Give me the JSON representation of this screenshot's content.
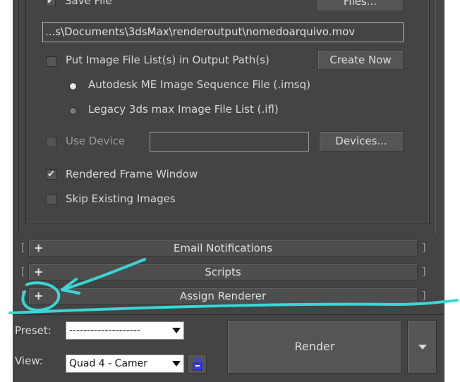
{
  "output": {
    "save_file_label": "Save File",
    "files_button": "Files...",
    "path_value": "...s\\Documents\\3dsMax\\renderoutput\\nomedoarquivo.mov",
    "put_image_list_label": "Put Image File List(s) in Output Path(s)",
    "put_image_list_checked": false,
    "create_now_button": "Create Now",
    "radio_imsq_label": "Autodesk ME Image Sequence File (.imsq)",
    "radio_ifl_label": "Legacy 3ds max Image File List (.ifl)",
    "selected_radio": "imsq",
    "use_device_label": "Use Device",
    "use_device_checked": false,
    "devices_button": "Devices...",
    "rendered_frame_window_label": "Rendered Frame Window",
    "rendered_frame_window_checked": true,
    "skip_existing_label": "Skip Existing Images",
    "skip_existing_checked": false,
    "checkmark_glyph": "✔"
  },
  "rollouts": [
    {
      "plus": "+",
      "title": "Email Notifications"
    },
    {
      "plus": "+",
      "title": "Scripts"
    },
    {
      "plus": "+",
      "title": "Assign Renderer"
    }
  ],
  "bottom": {
    "preset_label": "Preset:",
    "preset_value": "--------------------",
    "view_label": "View:",
    "view_value": "Quad 4 - Camer",
    "render_button": "Render"
  },
  "colors": {
    "panel_bg": "#444444",
    "annotation": "#3ad6d6"
  },
  "icons": {
    "lock": "lock-icon",
    "dropdown": "dropdown-arrow-icon"
  }
}
